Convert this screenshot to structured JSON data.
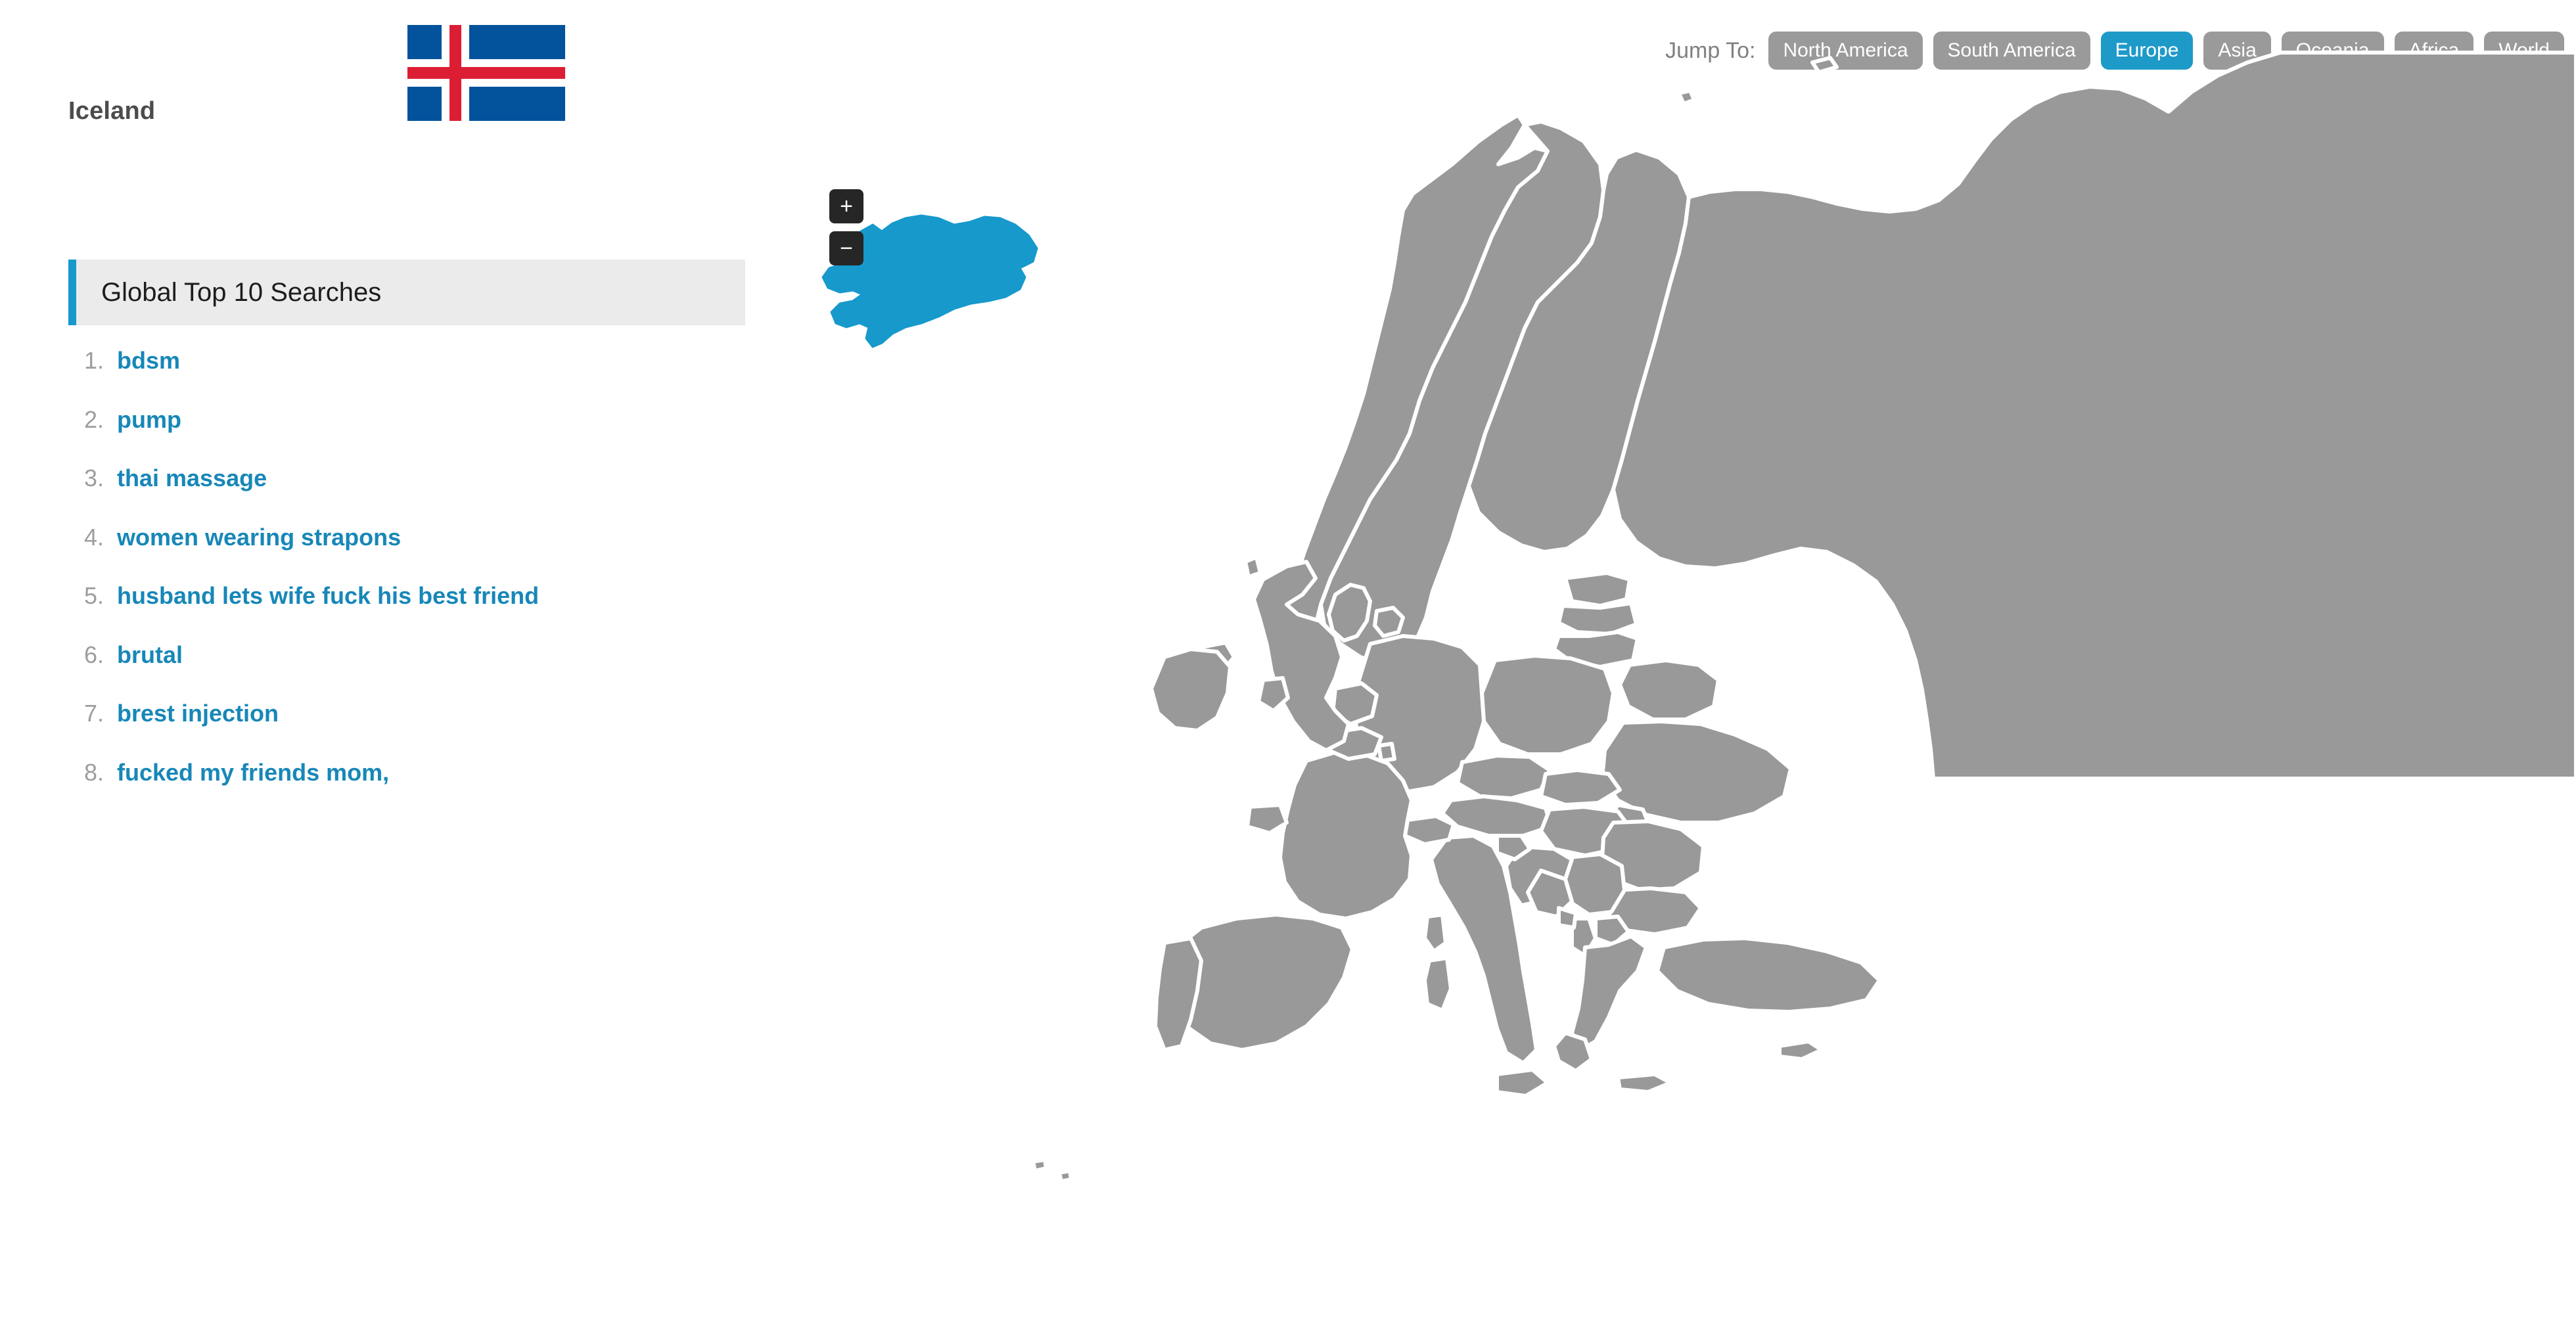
{
  "country": {
    "name": "Iceland",
    "flag": "iceland-flag",
    "highlight_color": "#1799CC"
  },
  "searches": {
    "header": "Global Top 10 Searches",
    "accent_color": "#1799CC",
    "items": [
      {
        "rank": "1.",
        "term": "bdsm"
      },
      {
        "rank": "2.",
        "term": "pump"
      },
      {
        "rank": "3.",
        "term": "thai massage"
      },
      {
        "rank": "4.",
        "term": "women wearing strapons"
      },
      {
        "rank": "5.",
        "term": "husband lets wife fuck his best friend"
      },
      {
        "rank": "6.",
        "term": "brutal"
      },
      {
        "rank": "7.",
        "term": "brest injection"
      },
      {
        "rank": "8.",
        "term": "fucked my friends mom,"
      }
    ]
  },
  "jump_nav": {
    "label": "Jump To:",
    "active": "Europe",
    "active_color": "#1E9AC9",
    "inactive_color": "#9a9a9a",
    "buttons": [
      "North America",
      "South America",
      "Europe",
      "Asia",
      "Oceania",
      "Africa",
      "World"
    ]
  },
  "map": {
    "region": "Europe",
    "land_color": "#999999",
    "border_color": "#ffffff",
    "water_color": "#ffffff",
    "selected_country": "Iceland",
    "selected_color": "#1799CC",
    "zoom_in_label": "+",
    "zoom_out_label": "−"
  }
}
